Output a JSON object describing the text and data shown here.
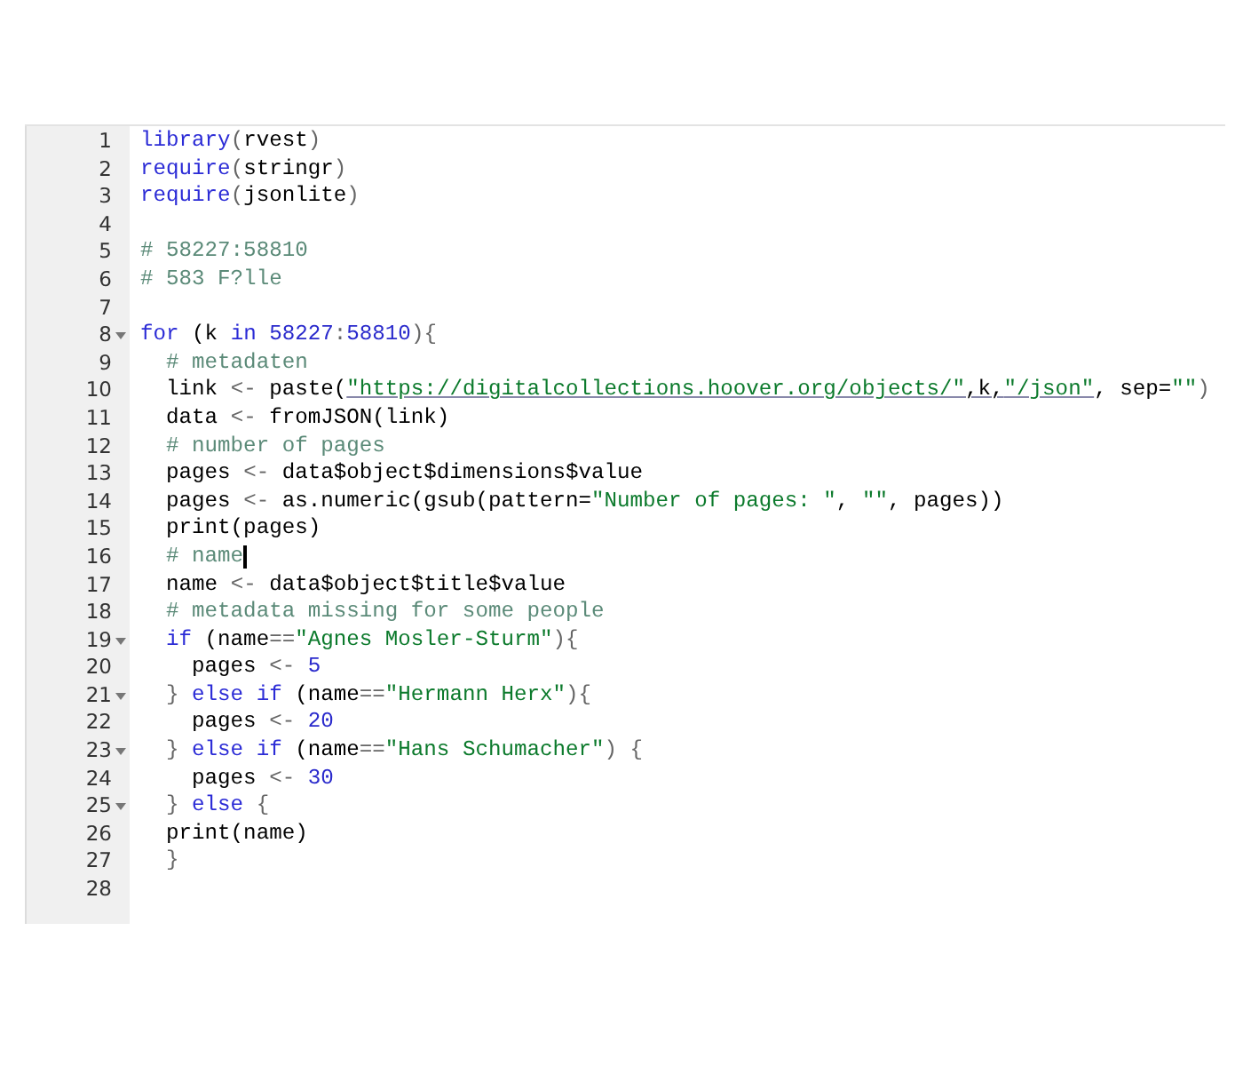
{
  "editor": {
    "lines": [
      {
        "number": "1",
        "fold": false,
        "cursor": false,
        "tokens": [
          {
            "text": "library",
            "kind": "keyword"
          },
          {
            "text": "(",
            "kind": "punct"
          },
          {
            "text": "rvest",
            "kind": "plain"
          },
          {
            "text": ")",
            "kind": "punct"
          }
        ]
      },
      {
        "number": "2",
        "fold": false,
        "cursor": false,
        "tokens": [
          {
            "text": "require",
            "kind": "keyword"
          },
          {
            "text": "(",
            "kind": "punct"
          },
          {
            "text": "stringr",
            "kind": "plain"
          },
          {
            "text": ")",
            "kind": "punct"
          }
        ]
      },
      {
        "number": "3",
        "fold": false,
        "cursor": false,
        "tokens": [
          {
            "text": "require",
            "kind": "keyword"
          },
          {
            "text": "(",
            "kind": "punct"
          },
          {
            "text": "jsonlite",
            "kind": "plain"
          },
          {
            "text": ")",
            "kind": "punct"
          }
        ]
      },
      {
        "number": "4",
        "fold": false,
        "cursor": false
      },
      {
        "number": "5",
        "fold": false,
        "cursor": false,
        "tokens": [
          {
            "text": "# 58227:58810",
            "kind": "comment"
          }
        ]
      },
      {
        "number": "6",
        "fold": false,
        "cursor": false,
        "tokens": [
          {
            "text": "# 583 F?lle",
            "kind": "comment"
          }
        ]
      },
      {
        "number": "7",
        "fold": false,
        "cursor": false
      },
      {
        "number": "8",
        "fold": true,
        "cursor": false,
        "tokens": [
          {
            "text": "for",
            "kind": "keyword"
          },
          {
            "text": " (k ",
            "kind": "plain"
          },
          {
            "text": "in",
            "kind": "keyword"
          },
          {
            "text": " 58227",
            "kind": "number"
          },
          {
            "text": ":",
            "kind": "punct"
          },
          {
            "text": "58810",
            "kind": "number"
          },
          {
            "text": "){",
            "kind": "punct"
          }
        ]
      },
      {
        "number": "9",
        "fold": false,
        "cursor": false,
        "tokens": [
          {
            "text": "  # metadaten",
            "kind": "comment"
          }
        ]
      },
      {
        "number": "10",
        "fold": false,
        "cursor": false,
        "tokens": [
          {
            "text": "  link ",
            "kind": "plain"
          },
          {
            "text": "<-",
            "kind": "punct"
          },
          {
            "text": " paste(",
            "kind": "plain"
          },
          {
            "text": "\"https://digitalcollections.hoover.org/objects/\"",
            "kind": "link"
          },
          {
            "text": ",k,",
            "kind": "linked"
          },
          {
            "text": "\"/json\"",
            "kind": "link"
          },
          {
            "text": ", sep=",
            "kind": "plain"
          },
          {
            "text": "\"\"",
            "kind": "string"
          },
          {
            "text": ")",
            "kind": "punct"
          }
        ]
      },
      {
        "number": "11",
        "fold": false,
        "cursor": false,
        "tokens": [
          {
            "text": "  data ",
            "kind": "plain"
          },
          {
            "text": "<-",
            "kind": "punct"
          },
          {
            "text": " fromJSON(link)",
            "kind": "plain"
          }
        ]
      },
      {
        "number": "12",
        "fold": false,
        "cursor": false,
        "tokens": [
          {
            "text": "  # number of pages",
            "kind": "comment"
          }
        ]
      },
      {
        "number": "13",
        "fold": false,
        "cursor": false,
        "tokens": [
          {
            "text": "  pages ",
            "kind": "plain"
          },
          {
            "text": "<-",
            "kind": "punct"
          },
          {
            "text": " data$object$dimensions$value",
            "kind": "plain"
          }
        ]
      },
      {
        "number": "14",
        "fold": false,
        "cursor": false,
        "tokens": [
          {
            "text": "  pages ",
            "kind": "plain"
          },
          {
            "text": "<-",
            "kind": "punct"
          },
          {
            "text": " as.numeric(gsub(pattern=",
            "kind": "plain"
          },
          {
            "text": "\"Number of pages: \"",
            "kind": "string"
          },
          {
            "text": ", ",
            "kind": "plain"
          },
          {
            "text": "\"\"",
            "kind": "string"
          },
          {
            "text": ", pages))",
            "kind": "plain"
          }
        ]
      },
      {
        "number": "15",
        "fold": false,
        "cursor": false,
        "tokens": [
          {
            "text": "  print(pages)",
            "kind": "plain"
          }
        ]
      },
      {
        "number": "16",
        "fold": false,
        "cursor": true,
        "tokens": [
          {
            "text": "  # name",
            "kind": "comment"
          }
        ]
      },
      {
        "number": "17",
        "fold": false,
        "cursor": false,
        "tokens": [
          {
            "text": "  name ",
            "kind": "plain"
          },
          {
            "text": "<-",
            "kind": "punct"
          },
          {
            "text": " data$object$title$value",
            "kind": "plain"
          }
        ]
      },
      {
        "number": "18",
        "fold": false,
        "cursor": false,
        "tokens": [
          {
            "text": "  # metadata missing for some people",
            "kind": "comment"
          }
        ]
      },
      {
        "number": "19",
        "fold": true,
        "cursor": false,
        "tokens": [
          {
            "text": "  if",
            "kind": "keyword"
          },
          {
            "text": " (name",
            "kind": "plain"
          },
          {
            "text": "==",
            "kind": "punct"
          },
          {
            "text": "\"Agnes Mosler-Sturm\"",
            "kind": "string"
          },
          {
            "text": "){",
            "kind": "punct"
          }
        ]
      },
      {
        "number": "20",
        "fold": false,
        "cursor": false,
        "tokens": [
          {
            "text": "    pages ",
            "kind": "plain"
          },
          {
            "text": "<-",
            "kind": "punct"
          },
          {
            "text": " 5",
            "kind": "number"
          }
        ]
      },
      {
        "number": "21",
        "fold": true,
        "cursor": false,
        "tokens": [
          {
            "text": "  } ",
            "kind": "punct"
          },
          {
            "text": "else if",
            "kind": "keyword"
          },
          {
            "text": " (name",
            "kind": "plain"
          },
          {
            "text": "==",
            "kind": "punct"
          },
          {
            "text": "\"Hermann Herx\"",
            "kind": "string"
          },
          {
            "text": "){",
            "kind": "punct"
          }
        ]
      },
      {
        "number": "22",
        "fold": false,
        "cursor": false,
        "tokens": [
          {
            "text": "    pages ",
            "kind": "plain"
          },
          {
            "text": "<-",
            "kind": "punct"
          },
          {
            "text": " 20",
            "kind": "number"
          }
        ]
      },
      {
        "number": "23",
        "fold": true,
        "cursor": false,
        "tokens": [
          {
            "text": "  } ",
            "kind": "punct"
          },
          {
            "text": "else if",
            "kind": "keyword"
          },
          {
            "text": " (name",
            "kind": "plain"
          },
          {
            "text": "==",
            "kind": "punct"
          },
          {
            "text": "\"Hans Schumacher\"",
            "kind": "string"
          },
          {
            "text": ") {",
            "kind": "punct"
          }
        ]
      },
      {
        "number": "24",
        "fold": false,
        "cursor": false,
        "tokens": [
          {
            "text": "    pages ",
            "kind": "plain"
          },
          {
            "text": "<-",
            "kind": "punct"
          },
          {
            "text": " 30",
            "kind": "number"
          }
        ]
      },
      {
        "number": "25",
        "fold": true,
        "cursor": false,
        "tokens": [
          {
            "text": "  } ",
            "kind": "punct"
          },
          {
            "text": "else",
            "kind": "keyword"
          },
          {
            "text": " {",
            "kind": "punct"
          }
        ]
      },
      {
        "number": "26",
        "fold": false,
        "cursor": false,
        "tokens": [
          {
            "text": "  print(name)",
            "kind": "plain"
          }
        ]
      },
      {
        "number": "27",
        "fold": false,
        "cursor": false,
        "tokens": [
          {
            "text": "  }",
            "kind": "punct"
          }
        ]
      },
      {
        "number": "28",
        "fold": false,
        "cursor": false
      }
    ]
  }
}
